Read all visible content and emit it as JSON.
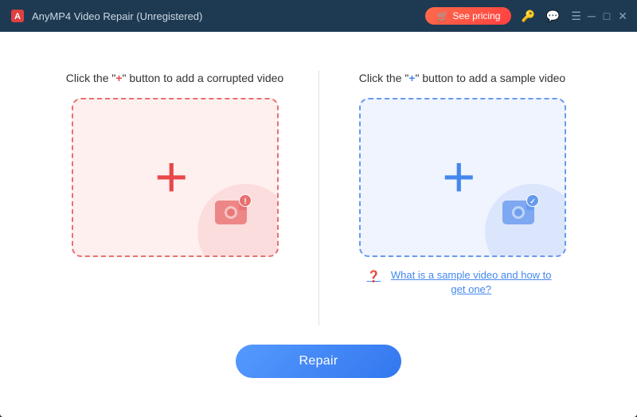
{
  "titlebar": {
    "title": "AnyMP4 Video Repair (Unregistered)",
    "pricing_label": "See pricing"
  },
  "left_panel": {
    "title_prefix": "Click the \"",
    "title_plus": "+",
    "title_suffix": "\" button to add a corrupted video"
  },
  "right_panel": {
    "title_prefix": "Click the \"",
    "title_plus": "+",
    "title_suffix": "\" button to add a sample video",
    "link_text": "What is a sample video and how to get one?"
  },
  "repair_button": {
    "label": "Repair"
  }
}
